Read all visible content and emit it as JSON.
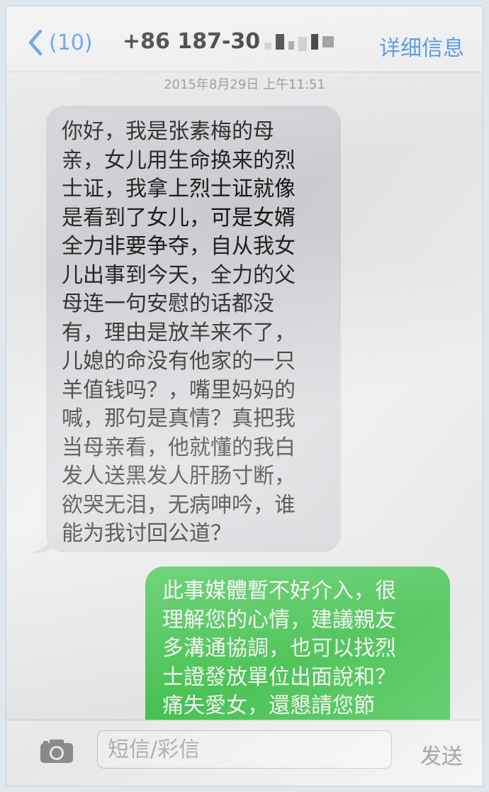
{
  "navbar": {
    "back_count": "(10)",
    "contact": "+86 187-30",
    "detail_label": "详细信息"
  },
  "timestamp": "2015年8月29日 上午11:51",
  "messages": [
    {
      "direction": "incoming",
      "text": "你好，我是张素梅的母\n亲，女儿用生命换来的烈\n士证，我拿上烈士证就像\n是看到了女儿，可是女婿\n全力非要争夺，自从我女\n儿出事到今天，全力的父\n母连一句安慰的话都没\n有，理由是放羊来不了，\n儿媳的命没有他家的一只\n羊值钱吗？，嘴里妈妈的\n喊，那句是真情？真把我\n当母亲看，他就懂的我白\n发人送黑发人肝肠寸断，\n欲哭无泪，无病呻吟，谁\n能为我讨回公道？"
    },
    {
      "direction": "outgoing",
      "text": "此事媒體暫不好介入，很\n理解您的心情，建議親友\n多溝通協調，也可以找烈\n士證發放單位出面說和？\n痛失愛女，還懇請您節\n哀。"
    }
  ],
  "composer": {
    "placeholder": "短信/彩信",
    "send_label": "发送"
  },
  "colors": {
    "accent": "#2f86ee",
    "incoming_bubble": "#d6d7db",
    "outgoing_bubble": "#3dc84a"
  },
  "icons": {
    "back": "chevron-left-icon",
    "camera": "camera-icon"
  }
}
